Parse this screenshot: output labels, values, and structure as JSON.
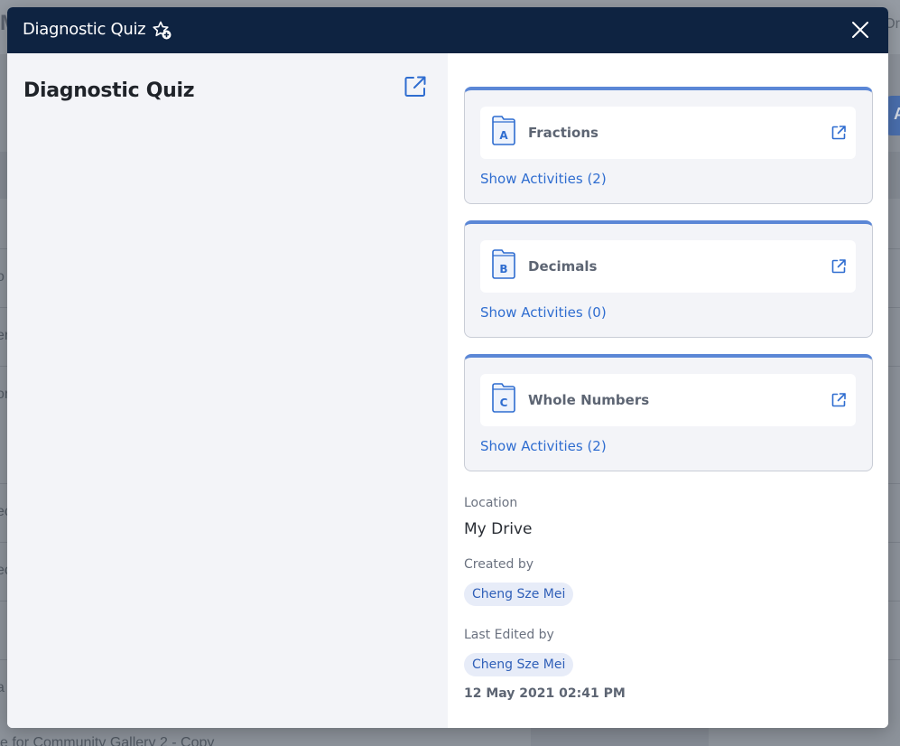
{
  "background": {
    "top_letter": "M",
    "top_right_text": "Or",
    "row_fragments": [
      "o",
      "er",
      "or",
      "ec",
      "ec",
      "i",
      "a"
    ],
    "button_letter": "A",
    "bottom_text": "e for Community Gallery 2 - Copy"
  },
  "modal": {
    "title": "Diagnostic Quiz",
    "star_icon": "star-plus-icon",
    "close_icon": "close-icon"
  },
  "left": {
    "title": "Diagnostic Quiz",
    "open_icon": "external-link-icon"
  },
  "units": [
    {
      "letter": "A",
      "name": "Fractions",
      "show_activities": "Show Activities (2)"
    },
    {
      "letter": "B",
      "name": "Decimals",
      "show_activities": "Show Activities (0)"
    },
    {
      "letter": "C",
      "name": "Whole Numbers",
      "show_activities": "Show Activities (2)"
    }
  ],
  "details": {
    "location_label": "Location",
    "location_value": "My Drive",
    "created_by_label": "Created by",
    "created_by": "Cheng Sze Mei",
    "last_edited_label": "Last Edited by",
    "last_edited_by": "Cheng Sze Mei",
    "last_edited_at": "12 May 2021 02:41 PM"
  },
  "colors": {
    "header_bg": "#0e2341",
    "accent_blue": "#2f6dd0",
    "card_top_border": "#5b87d6"
  }
}
